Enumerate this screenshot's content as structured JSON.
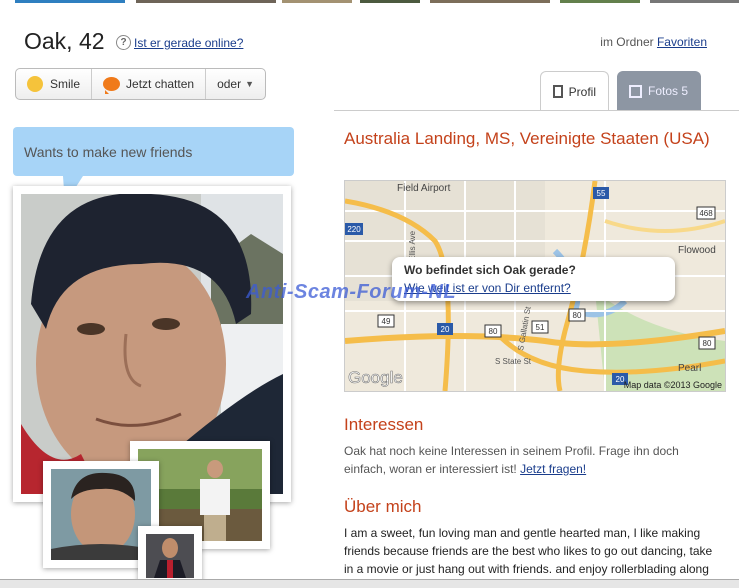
{
  "header": {
    "name_age": "Oak, 42",
    "help_glyph": "?",
    "online_link": "Ist er gerade online?",
    "folder_prefix": "im Ordner",
    "folder_link": "Favoriten"
  },
  "actions": {
    "smile": "Smile",
    "chat": "Jetzt chatten",
    "more": "oder"
  },
  "tabs": {
    "profil": "Profil",
    "fotos": "Fotos 5"
  },
  "status_bubble": "Wants to make new friends",
  "location": "Australia Landing, MS, Vereinigte Staaten (USA)",
  "map": {
    "labels": [
      "Field Airport",
      "Flowood",
      "Pearl",
      "S State St",
      "S Gallatin St",
      "Ellis Ave"
    ],
    "shields": [
      "55",
      "220",
      "468",
      "49",
      "20",
      "80",
      "51",
      "80",
      "20",
      "80"
    ],
    "logo": "Google",
    "attribution": "Map data ©2013 Google",
    "popup_question": "Wo befindet sich Oak gerade?",
    "popup_link": "Wie weit ist er von Dir entfernt?"
  },
  "watermark": "Anti-Scam-Forum-NL",
  "interests": {
    "heading": "Interessen",
    "text": "Oak hat noch keine Interessen in seinem Profil. Frage ihn doch einfach, woran er interessiert ist!",
    "link": "Jetzt fragen!"
  },
  "about": {
    "heading": "Über mich",
    "text": "I am a sweet, fun loving man and gentle hearted man, I like making friends because friends are the best who likes to go out dancing, take in a movie or just hang out with friends. and enjoy rollerblading along"
  },
  "colors": {
    "accent": "#c4421b",
    "link": "#1a3d8c",
    "bubble": "#a7d4f7",
    "tab_inactive": "#8d96a3"
  }
}
